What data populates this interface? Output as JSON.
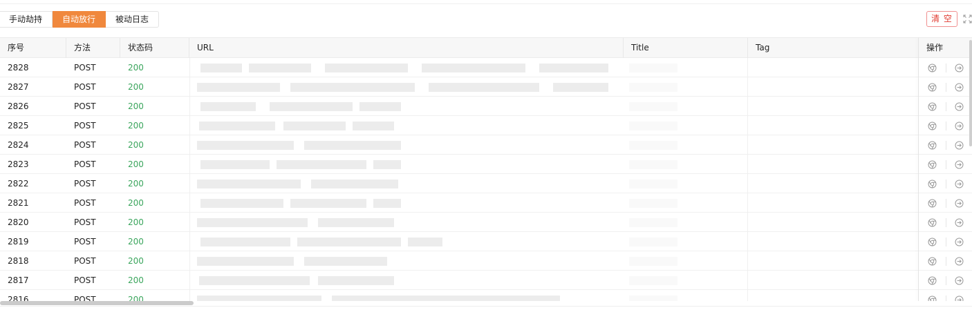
{
  "tabs": [
    {
      "label": "手动劫持",
      "active": false
    },
    {
      "label": "自动放行",
      "active": true
    },
    {
      "label": "被动日志",
      "active": false
    }
  ],
  "clear_label": "清 空",
  "icons": {
    "expand": "expand-icon",
    "open_browser": "chrome-icon",
    "forward": "arrow-right-circle-icon"
  },
  "colors": {
    "accent": "#f0883d",
    "status_ok": "#3aa55c",
    "danger": "#e0392f"
  },
  "columns": {
    "index": "序号",
    "method": "方法",
    "status": "状态码",
    "url": "URL",
    "title": "Title",
    "tag": "Tag",
    "actions": "操作"
  },
  "rows": [
    {
      "index": "2828",
      "method": "POST",
      "status": "200"
    },
    {
      "index": "2827",
      "method": "POST",
      "status": "200"
    },
    {
      "index": "2826",
      "method": "POST",
      "status": "200"
    },
    {
      "index": "2825",
      "method": "POST",
      "status": "200"
    },
    {
      "index": "2824",
      "method": "POST",
      "status": "200"
    },
    {
      "index": "2823",
      "method": "POST",
      "status": "200"
    },
    {
      "index": "2822",
      "method": "POST",
      "status": "200"
    },
    {
      "index": "2821",
      "method": "POST",
      "status": "200"
    },
    {
      "index": "2820",
      "method": "POST",
      "status": "200"
    },
    {
      "index": "2819",
      "method": "POST",
      "status": "200"
    },
    {
      "index": "2818",
      "method": "POST",
      "status": "200"
    },
    {
      "index": "2817",
      "method": "POST",
      "status": "200"
    },
    {
      "index": "2816",
      "method": "POST",
      "status": "200"
    }
  ]
}
